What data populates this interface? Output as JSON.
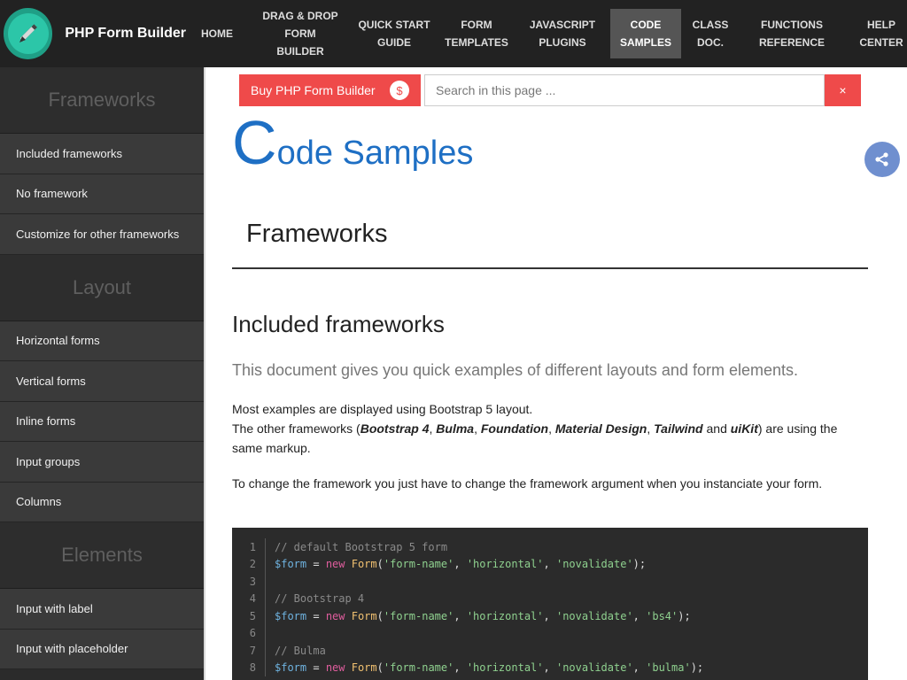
{
  "brand": {
    "name": "PHP Form Builder",
    "icon": "pencil-icon",
    "logo_color": "#2cc6a8"
  },
  "nav": [
    {
      "label": "HOME",
      "active": false
    },
    {
      "label": "DRAG & DROP FORM\nBUILDER",
      "active": false
    },
    {
      "label": "QUICK START\nGUIDE",
      "active": false
    },
    {
      "label": "FORM\nTEMPLATES",
      "active": false
    },
    {
      "label": "JAVASCRIPT\nPLUGINS",
      "active": false
    },
    {
      "label": "CODE\nSAMPLES",
      "active": true
    },
    {
      "label": "CLASS\nDOC.",
      "active": false
    },
    {
      "label": "FUNCTIONS\nREFERENCE",
      "active": false
    },
    {
      "label": "HELP\nCENTER",
      "active": false
    }
  ],
  "sidebar": {
    "sections": [
      {
        "heading": "Frameworks",
        "items": [
          "Included frameworks",
          "No framework",
          "Customize for other frameworks"
        ]
      },
      {
        "heading": "Layout",
        "items": [
          "Horizontal forms",
          "Vertical forms",
          "Inline forms",
          "Input groups",
          "Columns"
        ]
      },
      {
        "heading": "Elements",
        "items": [
          "Input with label",
          "Input with placeholder"
        ]
      }
    ]
  },
  "toolbar": {
    "buy_label": "Buy PHP Form Builder",
    "buy_icon": "$",
    "search_placeholder": "Search in this page ...",
    "clear_icon": "×",
    "accent": "#ef4a4a"
  },
  "page": {
    "title_first_letter": "C",
    "title_rest": "ode Samples",
    "title_color": "#1e6fc4",
    "section_title": "Frameworks",
    "subsection_title": "Included frameworks",
    "lead": "This document gives you quick examples of different layouts and form elements.",
    "para1_line1": "Most examples are displayed using Bootstrap 5 layout.",
    "para1_line2_start": "The other frameworks (",
    "fw_bs4": "Bootstrap 4",
    "fw_bulma": "Bulma",
    "fw_foundation": "Foundation",
    "fw_material": "Material Design",
    "fw_tailwind": "Tailwind",
    "fw_and": "and",
    "fw_uikit": "uiKit",
    "para1_line2_end": ") are using the same markup.",
    "para2": "To change the framework you just have to change the framework argument when you instanciate your form."
  },
  "code": {
    "line_numbers": [
      "1",
      "2",
      "3",
      "4",
      "5",
      "6",
      "7",
      "8"
    ],
    "comment1": "// default Bootstrap 5 form",
    "comment2": "// Bootstrap 4",
    "comment3": "// Bulma",
    "var": "$form",
    "eq": " = ",
    "kw": "new",
    "cls": "Form",
    "arg1": "'form-name'",
    "arg2": "'horizontal'",
    "arg3": "'novalidate'",
    "arg4_bs4": "'bs4'",
    "arg4_bulma": "'bulma'",
    "open": "(",
    "comma": ", ",
    "close": ");"
  }
}
